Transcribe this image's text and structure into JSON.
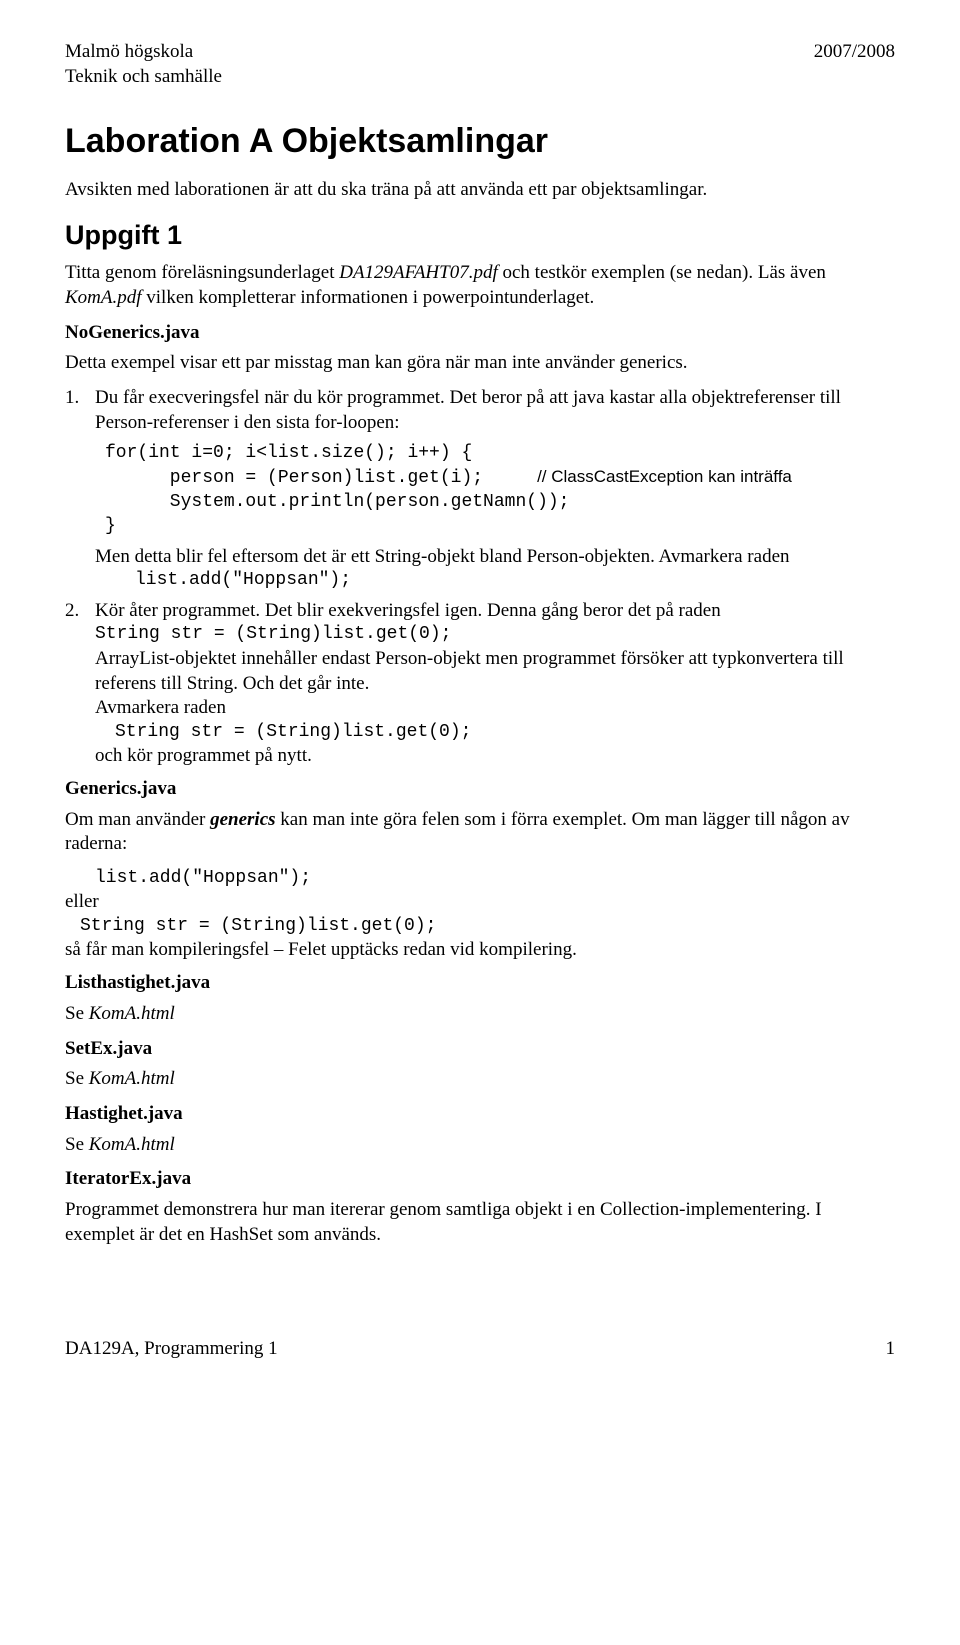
{
  "header": {
    "left_line1": "Malmö högskola",
    "left_line2": "Teknik och samhälle",
    "right": "2007/2008"
  },
  "title": "Laboration A Objektsamlingar",
  "intro": "Avsikten med laborationen är att du ska träna på att använda ett par objektsamlingar.",
  "uppgift1": "Uppgift 1",
  "p1_a": "Titta genom föreläsningsunderlaget ",
  "p1_b": "DA129AFAHT07.pdf",
  "p1_c": " och testkör exemplen (se nedan). Läs även ",
  "p1_d": "KomA.pdf",
  "p1_e": " vilken kompletterar informationen i powerpointunderlaget.",
  "s1": {
    "heading": "NoGenerics.java",
    "p": "Detta exempel visar ett par misstag man kan göra när man inte använder generics.",
    "item1_a": "Du får execveringsfel när du kör programmet. Det beror på att java kastar alla objektreferenser till Person-referenser i den sista for-loopen:",
    "code1_l1": "for(int i=0; i<list.size(); i++) {",
    "code1_l2a": "      person = (Person)list.get(i);",
    "code1_l2b": "// ClassCastException kan inträffa",
    "code1_l3": "      System.out.println(person.getNamn());",
    "code1_l4": "}",
    "item1_b": "Men detta blir fel eftersom det är ett String-objekt bland Person-objekten. Avmarkera raden",
    "item1_c": "list.add(\"Hoppsan\");",
    "item2_a": "Kör åter programmet. Det blir exekveringsfel igen. Denna gång beror det på raden",
    "item2_b": "String str = (String)list.get(0);",
    "item2_c": "ArrayList-objektet innehåller endast Person-objekt men programmet försöker att typkonvertera till referens till String. Och det går inte.",
    "item2_d": "Avmarkera raden",
    "item2_e": "String str = (String)list.get(0);",
    "item2_f": "och kör programmet på nytt."
  },
  "s2": {
    "heading": "Generics.java",
    "p_a": "Om man använder ",
    "p_b": "generics",
    "p_c": " kan man inte göra felen som i förra exemplet. Om man lägger till någon av raderna:",
    "code_a": "list.add(\"Hoppsan\");",
    "eller": "eller",
    "code_b": "String str = (String)list.get(0);",
    "p2": "så får man kompileringsfel – Felet upptäcks redan vid kompilering."
  },
  "s3": {
    "heading": "Listhastighet.java",
    "p_a": "Se ",
    "p_b": "KomA.html"
  },
  "s4": {
    "heading": "SetEx.java",
    "p_a": "Se ",
    "p_b": "KomA.html"
  },
  "s5": {
    "heading": "Hastighet.java",
    "p_a": "Se ",
    "p_b": "KomA.html"
  },
  "s6": {
    "heading": "IteratorEx.java",
    "p": "Programmet demonstrera hur man itererar genom samtliga objekt i en Collection-implementering. I exemplet är det en HashSet som används."
  },
  "footer": {
    "left": "DA129A, Programmering 1",
    "right": "1"
  },
  "nums": {
    "one": "1.",
    "two": "2."
  }
}
